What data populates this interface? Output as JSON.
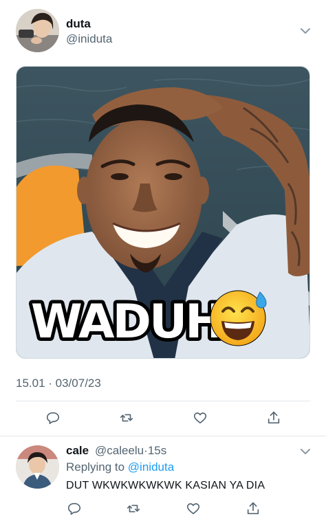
{
  "tweet": {
    "display_name": "duta",
    "handle": "@iniduta",
    "timestamp": "15.01 · 03/07/23",
    "media": {
      "caption": "WADUH",
      "emoji": "grinning-face-with-sweat-icon"
    },
    "actions": [
      "reply-icon",
      "retweet-icon",
      "like-icon",
      "share-icon"
    ]
  },
  "reply": {
    "display_name": "cale",
    "handle": "@caleelu",
    "separator": "·",
    "time": "15s",
    "replying_prefix": "Replying to",
    "replying_to": "@iniduta",
    "text": "DUT WKWKWKWKWK KASIAN YA DIA",
    "actions": [
      "reply-icon",
      "retweet-icon",
      "like-icon",
      "share-icon"
    ]
  },
  "colors": {
    "text": "#0f1419",
    "secondary": "#536471",
    "link": "#1d9bf0",
    "divider": "#e1e6ea"
  }
}
